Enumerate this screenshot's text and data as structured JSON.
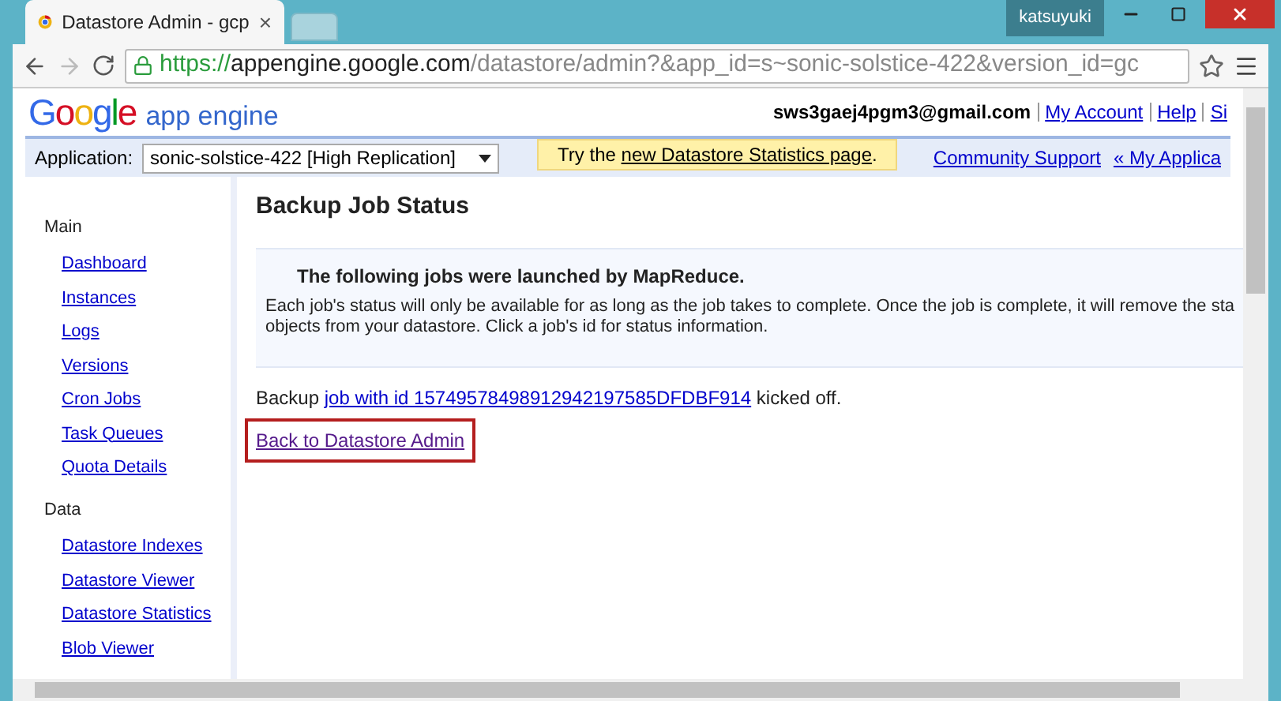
{
  "window": {
    "user": "katsuyuki"
  },
  "tab": {
    "title": "Datastore Admin - gcp",
    "close": "×"
  },
  "address_bar": {
    "scheme": "https://",
    "host": "appengine.google.com",
    "path": "/datastore/admin?&app_id=s~sonic-solstice-422&version_id=gc"
  },
  "header": {
    "logo": "Google",
    "product": "app engine",
    "email": "sws3gaej4pgm3@gmail.com",
    "links": [
      "My Account",
      "Help",
      "Si"
    ]
  },
  "app_bar": {
    "label": "Application:",
    "app_select": "sonic-solstice-422 [High Replication]",
    "notice_prefix": "Try the ",
    "notice_link": "new Datastore Statistics page",
    "notice_suffix": ".",
    "links": [
      "Community Support",
      "« My Applica"
    ]
  },
  "sidebar": [
    {
      "heading": "Main",
      "items": [
        "Dashboard",
        "Instances",
        "Logs",
        "Versions",
        "Cron Jobs",
        "Task Queues",
        "Quota Details"
      ]
    },
    {
      "heading": "Data",
      "items": [
        "Datastore Indexes",
        "Datastore Viewer",
        "Datastore Statistics",
        "Blob Viewer"
      ]
    }
  ],
  "main": {
    "title": "Backup Job Status",
    "info_heading": "The following jobs were launched by MapReduce.",
    "info_lines": [
      "Each job's status will only be available for as long as the job takes to complete. Once the job is complete, it will remove the sta",
      "objects from your datastore. Click a job's id for status information."
    ],
    "backup_prefix": "Backup ",
    "backup_link": "job with id 15749578498912942197585DFDBF914",
    "backup_suffix": " kicked off.",
    "back_link": "Back to Datastore Admin",
    "back_link_highlighted": true
  }
}
